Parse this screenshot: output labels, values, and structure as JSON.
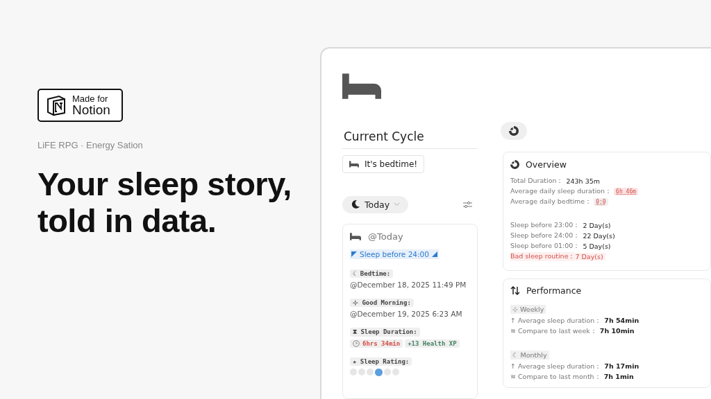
{
  "hero": {
    "badge": {
      "line1": "Made for",
      "line2": "Notion"
    },
    "subtitle": "LiFE RPG · Energy Sation",
    "headline": "Your sleep story, told in data."
  },
  "window": {
    "heading": "Current Cycle",
    "bedtime_button": "It's bedtime!",
    "view_pill": {
      "label": "Today"
    },
    "entry": {
      "title": "@Today",
      "status_tag": "Sleep before 24:00",
      "properties": [
        {
          "kind": "date",
          "label": "☾ Bedtime:",
          "value": "@December 18, 2025 11:49 PM"
        },
        {
          "kind": "date",
          "label": "⊹ Good Morning:",
          "value": "@December 19, 2025 6:23 AM"
        },
        {
          "kind": "badges",
          "label": "⧗ Sleep Duration:",
          "badges": [
            {
              "text": "6hrs 34min",
              "color": "#d44c47",
              "clock": true
            },
            {
              "text": "+13 Health XP",
              "color": "#448361",
              "clock": false
            }
          ]
        },
        {
          "kind": "rating",
          "label": "★ Sleep Rating:",
          "dots": [
            {
              "selected": false
            },
            {
              "selected": false
            },
            {
              "selected": false
            },
            {
              "selected": true
            },
            {
              "selected": false
            },
            {
              "selected": false
            }
          ]
        }
      ]
    }
  },
  "overview": {
    "title": "Overview",
    "groups": [
      [
        {
          "kind": "plain",
          "label": "Total Duration：",
          "value": "243h 35m"
        },
        {
          "kind": "tag",
          "label": "Average daily sleep duration：",
          "value": "6h 46m"
        },
        {
          "kind": "code",
          "label": "Average daily bedtime：",
          "value": "0:0"
        }
      ],
      [
        {
          "kind": "plain",
          "label": "Sleep before 23:00：",
          "value": "2 Day(s)"
        },
        {
          "kind": "plain",
          "label": "Sleep before 24:00：",
          "value": "22 Day(s)"
        },
        {
          "kind": "plain",
          "label": "Sleep before 01:00：",
          "value": "5 Day(s)"
        },
        {
          "kind": "alert",
          "label": "Bad sleep routine：",
          "value": "7 Day(s)"
        }
      ]
    ]
  },
  "performance": {
    "title": "Performance",
    "sections": [
      {
        "heading": "⊹ Weekly",
        "rows": [
          {
            "label": "↑ Average sleep duration：",
            "value": "7h 54min"
          },
          {
            "label": "≋ Compare to last week：",
            "value": "7h 10min"
          }
        ]
      },
      {
        "heading": "☾ Monthly",
        "rows": [
          {
            "label": "↑ Average sleep duration：",
            "value": "7h 17min"
          },
          {
            "label": "≋ Compare to last month：",
            "value": "7h 1min"
          }
        ]
      }
    ]
  }
}
